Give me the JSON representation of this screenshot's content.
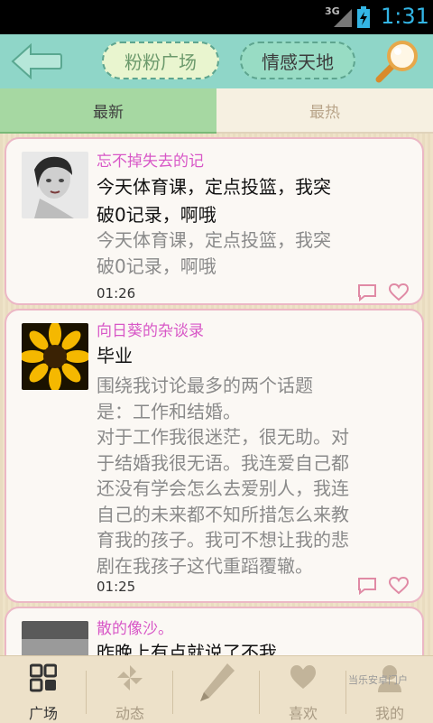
{
  "status_bar": {
    "network": "3G",
    "time": "1:31"
  },
  "header": {
    "square_label": "粉粉广场",
    "emotion_label": "情感天地"
  },
  "tabs": [
    {
      "label": "最新",
      "active": true
    },
    {
      "label": "最热",
      "active": false
    }
  ],
  "posts": [
    {
      "author": "忘不掉失去的记",
      "title": "今天体育课，定点投篮，我突\n破0记录，啊哦",
      "body": "今天体育课，定点投篮，我突\n破0记录，啊哦",
      "time": "01:26"
    },
    {
      "author": "向日葵的杂谈录",
      "title": "毕业",
      "body": "围绕我讨论最多的两个话题\n是：工作和结婚。\n对于工作我很迷茫，很无助。对\n于结婚我很无语。我连爱自己都\n还没有学会怎么去爱别人，我连\n自己的未来都不知所措怎么来教\n育我的孩子。我可不想让我的悲\n剧在我孩子这代重蹈覆辙。",
      "time": "01:25"
    },
    {
      "author": "散的像沙。",
      "title": "昨晚上有点就说了不我",
      "body": "",
      "time": ""
    }
  ],
  "bottom_nav": [
    {
      "label": "广场",
      "icon": "grid-icon",
      "active": true
    },
    {
      "label": "动态",
      "icon": "pinwheel-icon",
      "active": false
    },
    {
      "label": "",
      "icon": "pencil-icon",
      "active": false
    },
    {
      "label": "喜欢",
      "icon": "heart-icon",
      "active": false
    },
    {
      "label": "我的",
      "icon": "user-icon",
      "active": false
    }
  ],
  "watermark": "当乐安卓门户",
  "colors": {
    "header_bg": "#8fd6c8",
    "author_text": "#d858c7",
    "card_border": "#ecb7c5",
    "tab_active": "#a6d8a2",
    "statusbar_accent": "#33b5e5"
  }
}
